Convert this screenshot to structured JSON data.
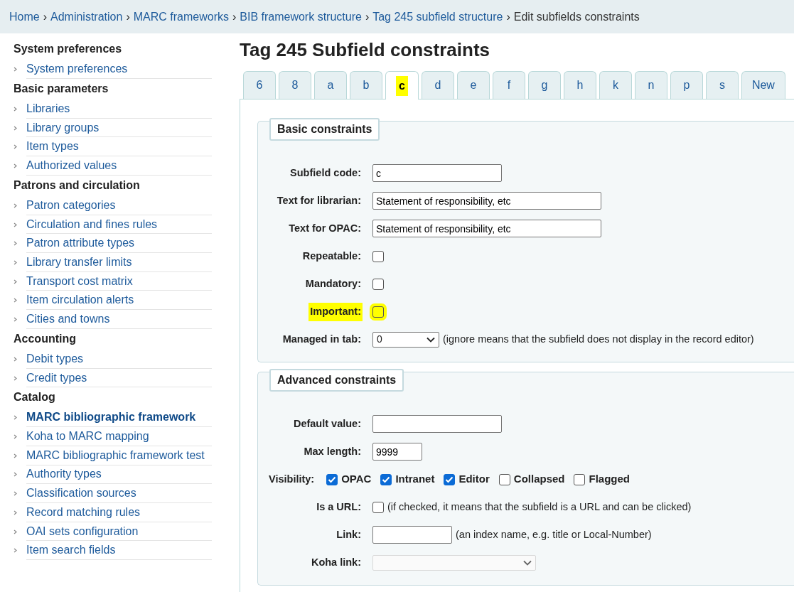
{
  "breadcrumbs": [
    {
      "label": "Home",
      "current": false
    },
    {
      "label": "Administration",
      "current": false
    },
    {
      "label": "MARC frameworks",
      "current": false
    },
    {
      "label": "BIB framework structure",
      "current": false
    },
    {
      "label": "Tag 245 subfield structure",
      "current": false
    },
    {
      "label": "Edit subfields constraints",
      "current": true
    }
  ],
  "breadcrumb_separator": "›",
  "sidebar": [
    {
      "heading": "System preferences",
      "items": [
        {
          "label": "System preferences",
          "selected": false
        }
      ]
    },
    {
      "heading": "Basic parameters",
      "items": [
        {
          "label": "Libraries",
          "selected": false
        },
        {
          "label": "Library groups",
          "selected": false
        },
        {
          "label": "Item types",
          "selected": false
        },
        {
          "label": "Authorized values",
          "selected": false
        }
      ]
    },
    {
      "heading": "Patrons and circulation",
      "items": [
        {
          "label": "Patron categories",
          "selected": false
        },
        {
          "label": "Circulation and fines rules",
          "selected": false
        },
        {
          "label": "Patron attribute types",
          "selected": false
        },
        {
          "label": "Library transfer limits",
          "selected": false
        },
        {
          "label": "Transport cost matrix",
          "selected": false
        },
        {
          "label": "Item circulation alerts",
          "selected": false
        },
        {
          "label": "Cities and towns",
          "selected": false
        }
      ]
    },
    {
      "heading": "Accounting",
      "items": [
        {
          "label": "Debit types",
          "selected": false
        },
        {
          "label": "Credit types",
          "selected": false
        }
      ]
    },
    {
      "heading": "Catalog",
      "items": [
        {
          "label": "MARC bibliographic framework",
          "selected": true
        },
        {
          "label": "Koha to MARC mapping",
          "selected": false
        },
        {
          "label": "MARC bibliographic framework test",
          "selected": false
        },
        {
          "label": "Authority types",
          "selected": false
        },
        {
          "label": "Classification sources",
          "selected": false
        },
        {
          "label": "Record matching rules",
          "selected": false
        },
        {
          "label": "OAI sets configuration",
          "selected": false
        },
        {
          "label": "Item search fields",
          "selected": false
        }
      ]
    }
  ],
  "page_title": "Tag 245 Subfield constraints",
  "tabs": [
    {
      "label": "6",
      "selected": false
    },
    {
      "label": "8",
      "selected": false
    },
    {
      "label": "a",
      "selected": false
    },
    {
      "label": "b",
      "selected": false
    },
    {
      "label": "c",
      "selected": true,
      "highlighted": true
    },
    {
      "label": "d",
      "selected": false
    },
    {
      "label": "e",
      "selected": false
    },
    {
      "label": "f",
      "selected": false
    },
    {
      "label": "g",
      "selected": false
    },
    {
      "label": "h",
      "selected": false
    },
    {
      "label": "k",
      "selected": false
    },
    {
      "label": "n",
      "selected": false
    },
    {
      "label": "p",
      "selected": false
    },
    {
      "label": "s",
      "selected": false
    },
    {
      "label": "New",
      "selected": false
    }
  ],
  "fieldsets": [
    {
      "legend": "Basic constraints",
      "fields": [
        {
          "kind": "text",
          "label": "Subfield code:",
          "value": "c"
        },
        {
          "kind": "text-long",
          "label": "Text for librarian:",
          "value": "Statement of responsibility, etc"
        },
        {
          "kind": "text-long",
          "label": "Text for OPAC:",
          "value": "Statement of responsibility, etc"
        },
        {
          "kind": "checkbox",
          "label": "Repeatable:",
          "checked": false
        },
        {
          "kind": "checkbox",
          "label": "Mandatory:",
          "checked": false
        },
        {
          "kind": "checkbox",
          "label": "Important:",
          "checked": false,
          "highlighted": true
        },
        {
          "kind": "select",
          "label": "Managed in tab:",
          "value": "0",
          "disabled": false,
          "note": "(ignore means that the subfield does not display in the record editor)"
        }
      ]
    },
    {
      "legend": "Advanced constraints",
      "fields": [
        {
          "kind": "text",
          "label": "Default value:"
        },
        {
          "kind": "text-short",
          "label": "Max length:",
          "value": "9999"
        },
        {
          "kind": "checkgroup",
          "label": "Visibility:",
          "options": [
            {
              "label": "OPAC",
              "checked": true
            },
            {
              "label": "Intranet",
              "checked": true
            },
            {
              "label": "Editor",
              "checked": true
            },
            {
              "label": "Collapsed",
              "checked": false
            },
            {
              "label": "Flagged",
              "checked": false
            }
          ]
        },
        {
          "kind": "checkbox",
          "label": "Is a URL:",
          "checked": false,
          "note": "(if checked, it means that the subfield is a URL and can be clicked)"
        },
        {
          "kind": "text-mid",
          "label": "Link:",
          "note": "(an index name, e.g. title or Local-Number)"
        },
        {
          "kind": "select-wide",
          "label": "Koha link:",
          "disabled": true
        }
      ]
    }
  ]
}
